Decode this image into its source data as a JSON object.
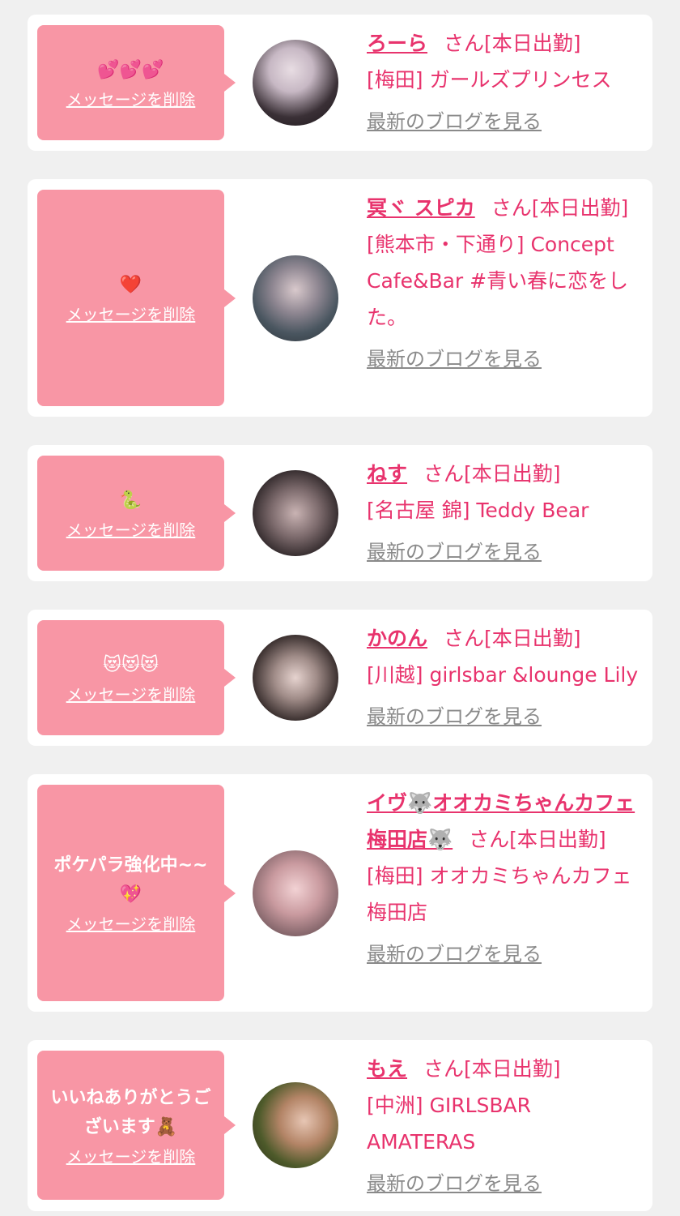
{
  "delete_label": "メッセージを削除",
  "blog_label": "最新のブログを見る",
  "san_label": "さん[本日出勤]",
  "colors": {
    "bubble": "#f896a5",
    "accent": "#e8336d",
    "link_gray": "#8a8a8a",
    "background": "#f0f0f0"
  },
  "cards": [
    {
      "message": "💕💕💕",
      "name": "ろーら",
      "shop": "[梅田] ガールズプリンセス"
    },
    {
      "message": "❤️",
      "name": "冥ヾ スピカ",
      "shop": "[熊本市・下通り] Concept Cafe&Bar #青い春に恋をした。"
    },
    {
      "message": "🐍",
      "name": "ねす",
      "shop": "[名古屋 錦] Teddy Bear"
    },
    {
      "message": "😻😻😻",
      "name": "かのん",
      "shop": "[川越] girlsbar &lounge Lily"
    },
    {
      "message": "ポケパラ強化中~~💖",
      "name": "イヴ🐺オオカミちゃんカフェ梅田店🐺",
      "shop": "[梅田] オオカミちゃんカフェ梅田店"
    },
    {
      "message": "いいねありがとうございます🧸",
      "name": "もえ",
      "shop": "[中洲] GIRLSBAR AMATERAS"
    }
  ]
}
